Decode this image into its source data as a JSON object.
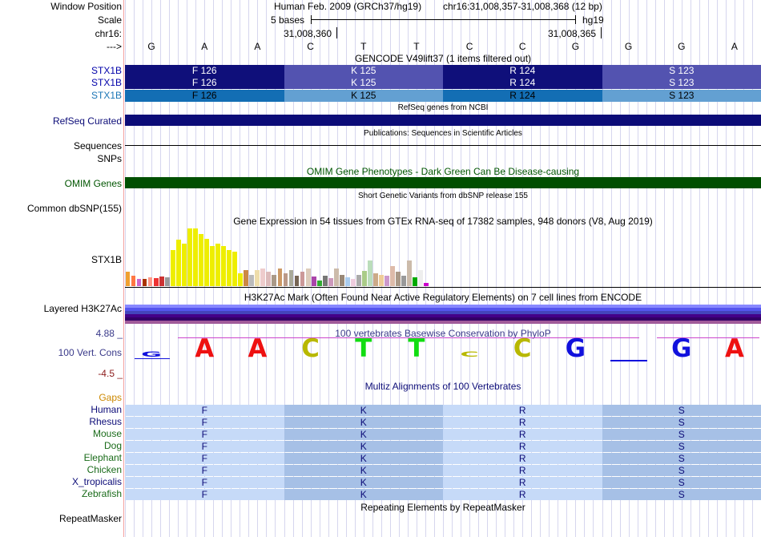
{
  "ruler": {
    "window_position_label": "Window Position",
    "scale_label": "Scale",
    "chrom_label": "chr16:",
    "strand_label": "--->",
    "assembly": "Human Feb. 2009 (GRCh37/hg19)",
    "position": "chr16:31,008,357-31,008,368 (12 bp)",
    "scale_text": "5 bases",
    "db": "hg19",
    "coord_1": "31,008,360",
    "coord_2": "31,008,365",
    "bases": [
      "G",
      "A",
      "A",
      "C",
      "T",
      "T",
      "C",
      "C",
      "G",
      "G",
      "G",
      "A"
    ]
  },
  "gencode": {
    "title": "GENCODE V49lift37 (1 items filtered out)",
    "rows": [
      {
        "name": "STX1B",
        "colors": [
          "#0f0f7a",
          "#5353b0"
        ]
      },
      {
        "name": "STX1B",
        "colors": [
          "#0f0f7a",
          "#5353b0"
        ]
      },
      {
        "name": "STX1B",
        "colors": [
          "#136eb4",
          "#63a0d2"
        ]
      }
    ],
    "codons": [
      {
        "aa": "F 126"
      },
      {
        "aa": "K 125"
      },
      {
        "aa": "R 124"
      },
      {
        "aa": "S 123"
      }
    ]
  },
  "refseq": {
    "title": "RefSeq genes from NCBI",
    "label": "RefSeq Curated"
  },
  "publications": {
    "title": "Publications: Sequences in Scientific Articles",
    "sequences_label": "Sequences",
    "snps_label": "SNPs"
  },
  "omim": {
    "title": "OMIM Gene Phenotypes - Dark Green Can Be Disease-causing",
    "label": "OMIM Genes"
  },
  "dbsnp": {
    "title": "Short Genetic Variants from dbSNP release 155",
    "label": "Common dbSNP(155)"
  },
  "gtex": {
    "title": "Gene Expression in 54 tissues from GTEx RNA-seq of 17382 samples, 948 donors (V8, Aug 2019)",
    "label": "STX1B",
    "bars": [
      {
        "v": 0.25,
        "c": "#f0a030"
      },
      {
        "v": 0.18,
        "c": "#ff7744"
      },
      {
        "v": 0.13,
        "c": "#cc66cc"
      },
      {
        "v": 0.12,
        "c": "#aa3300"
      },
      {
        "v": 0.15,
        "c": "#ff9988"
      },
      {
        "v": 0.14,
        "c": "#ee3333"
      },
      {
        "v": 0.16,
        "c": "#cc3333"
      },
      {
        "v": 0.15,
        "c": "#999999"
      },
      {
        "v": 0.62,
        "c": "#eeee00"
      },
      {
        "v": 0.8,
        "c": "#eeee00"
      },
      {
        "v": 0.74,
        "c": "#eeee00"
      },
      {
        "v": 1.0,
        "c": "#eeee00"
      },
      {
        "v": 1.0,
        "c": "#eeee00"
      },
      {
        "v": 0.9,
        "c": "#eeee00"
      },
      {
        "v": 0.82,
        "c": "#eeee00"
      },
      {
        "v": 0.7,
        "c": "#eeee00"
      },
      {
        "v": 0.74,
        "c": "#eeee00"
      },
      {
        "v": 0.7,
        "c": "#eeee00"
      },
      {
        "v": 0.62,
        "c": "#eeee00"
      },
      {
        "v": 0.6,
        "c": "#eeee00"
      },
      {
        "v": 0.22,
        "c": "#eeee00"
      },
      {
        "v": 0.28,
        "c": "#cc8844"
      },
      {
        "v": 0.2,
        "c": "#bbbbbb"
      },
      {
        "v": 0.28,
        "c": "#eeddaa"
      },
      {
        "v": 0.3,
        "c": "#eecccc"
      },
      {
        "v": 0.25,
        "c": "#ddbbbb"
      },
      {
        "v": 0.2,
        "c": "#aa9988"
      },
      {
        "v": 0.3,
        "c": "#cc9966"
      },
      {
        "v": 0.22,
        "c": "#bb9988"
      },
      {
        "v": 0.28,
        "c": "#aaaa99"
      },
      {
        "v": 0.18,
        "c": "#776655"
      },
      {
        "v": 0.25,
        "c": "#cc9999"
      },
      {
        "v": 0.3,
        "c": "#ddccbb"
      },
      {
        "v": 0.16,
        "c": "#aa44aa"
      },
      {
        "v": 0.1,
        "c": "#33aa33"
      },
      {
        "v": 0.18,
        "c": "#777777"
      },
      {
        "v": 0.14,
        "c": "#cc99bb"
      },
      {
        "v": 0.3,
        "c": "#ccbbaa"
      },
      {
        "v": 0.2,
        "c": "#998877"
      },
      {
        "v": 0.15,
        "c": "#aaccee"
      },
      {
        "v": 0.12,
        "c": "#eeccdd"
      },
      {
        "v": 0.2,
        "c": "#aaaaaa"
      },
      {
        "v": 0.26,
        "c": "#aacc88"
      },
      {
        "v": 0.45,
        "c": "#bbddbb"
      },
      {
        "v": 0.22,
        "c": "#ccaa88"
      },
      {
        "v": 0.2,
        "c": "#eecc99"
      },
      {
        "v": 0.18,
        "c": "#cc99cc"
      },
      {
        "v": 0.35,
        "c": "#ddbbaa"
      },
      {
        "v": 0.25,
        "c": "#aa9988"
      },
      {
        "v": 0.18,
        "c": "#999999"
      },
      {
        "v": 0.45,
        "c": "#ccbbaa"
      },
      {
        "v": 0.15,
        "c": "#00aa00"
      },
      {
        "v": 0.28,
        "c": "#eeeeee"
      },
      {
        "v": 0.05,
        "c": "#cc00cc"
      }
    ]
  },
  "h3k27ac": {
    "title": "H3K27Ac Mark (Often Found Near Active Regulatory Elements) on 7 cell lines from ENCODE",
    "label": "Layered H3K27Ac",
    "bands": [
      "#8888ff",
      "#5555ee",
      "#4444bb",
      "#440088",
      "#330066",
      "#a05a9a"
    ]
  },
  "conservation": {
    "title": "100 vertebrates Basewise Conservation by PhyloP",
    "label": "100 Vert. Cons",
    "max_label": "4.88 _",
    "min_label": "-4.5 _",
    "values": [
      0.05,
      1.0,
      1.0,
      1.0,
      1.0,
      1.0,
      0.2,
      1.0,
      1.0,
      -0.1,
      1.0,
      1.0
    ],
    "base_colors": {
      "A": "#ee1111",
      "C": "#b8b800",
      "G": "#1111dd",
      "T": "#11dd11"
    }
  },
  "multiz": {
    "title": "Multiz Alignments of 100 Vertebrates",
    "gaps_label": "Gaps",
    "species": [
      {
        "name": "Human",
        "color": "#0c0c78"
      },
      {
        "name": "Rhesus",
        "color": "#0c0c78"
      },
      {
        "name": "Mouse",
        "color": "#1a6b1a"
      },
      {
        "name": "Dog",
        "color": "#1a6b1a"
      },
      {
        "name": "Elephant",
        "color": "#1a6b1a"
      },
      {
        "name": "Chicken",
        "color": "#1a6b1a"
      },
      {
        "name": "X_tropicalis",
        "color": "#0c0c78"
      },
      {
        "name": "Zebrafish",
        "color": "#1a6b1a"
      }
    ],
    "aa": [
      "F",
      "K",
      "R",
      "S"
    ],
    "colors": [
      "#c6daf8",
      "#a6c0e6"
    ]
  },
  "repeatmasker": {
    "title": "Repeating Elements by RepeatMasker",
    "label": "RepeatMasker"
  }
}
